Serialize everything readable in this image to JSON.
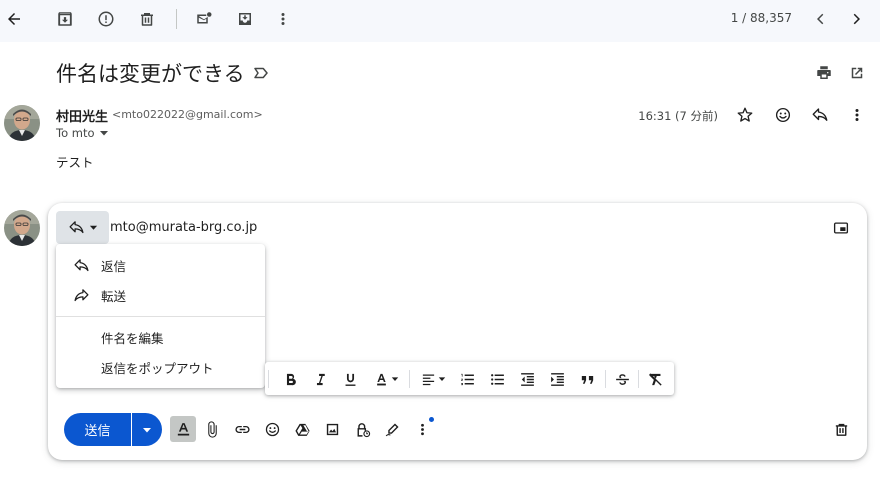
{
  "toolbar": {
    "counter": "1 / 88,357"
  },
  "subject": "件名は変更ができる",
  "message": {
    "sender_name": "村田光生",
    "sender_email": "<mto022022@gmail.com>",
    "to_label": "To mto",
    "time": "16:31 (7 分前)",
    "body": "テスト"
  },
  "compose": {
    "recipient": "mto@murata-brg.co.jp",
    "send_label": "送信"
  },
  "reply_menu": {
    "items": [
      {
        "label": "返信",
        "icon": "reply-icon"
      },
      {
        "label": "転送",
        "icon": "forward-icon"
      },
      {
        "label": "件名を編集",
        "icon": ""
      },
      {
        "label": "返信をポップアウト",
        "icon": ""
      }
    ]
  },
  "colors": {
    "accent": "#0b57d0",
    "toolbar_bg": "#f6f8fc",
    "icon": "#444746"
  }
}
